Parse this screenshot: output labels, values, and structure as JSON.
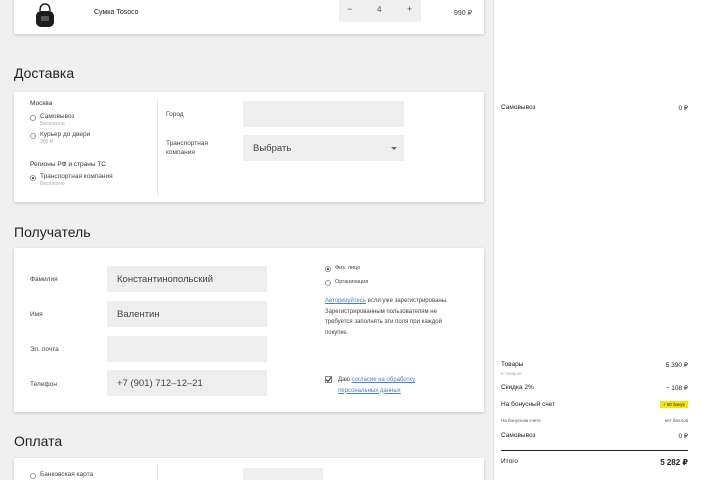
{
  "product": {
    "name": "Сумка Tosoco",
    "qty": "4",
    "minus": "−",
    "plus": "+",
    "price": "990 ₽"
  },
  "delivery": {
    "title": "Доставка",
    "moscow": {
      "heading": "Москва",
      "pickup": "Самовывоз",
      "pickup_sub": "Бесплатно",
      "courier": "Курьер до двери",
      "courier_sub": "300 ₽"
    },
    "regions": {
      "heading": "Регионы РФ и страны ТС",
      "tk": "Транспортная компания",
      "tk_sub": "Бесплатно"
    },
    "city_label": "Город",
    "tk_label": "Транспортная компания",
    "select_value": "Выбрать"
  },
  "recipient": {
    "title": "Получатель",
    "surname_label": "Фамилия",
    "surname_value": "Константинопольский",
    "name_label": "Имя",
    "name_value": "Валентин",
    "email_label": "Эл. почта",
    "email_value": "",
    "phone_label": "Телефон",
    "phone_value": "+7 (901) 712–12–21",
    "person_individual": "Физ. лицо",
    "person_org": "Организация",
    "auth_link": "Авторизуйтесь",
    "auth_rest": "если уже зарегистрированы. Зарегистрированным пользователям не требуется заполнять эти поля при каждой покупке.",
    "consent_prefix": "Даю",
    "consent_link": "согласие на обработку персональных данных"
  },
  "payment": {
    "title": "Оплата",
    "bank_card": "Банковская карта"
  },
  "summary": {
    "pickup_label": "Самовывоз",
    "pickup_value": "0 ₽",
    "goods_label": "Товары",
    "goods_value": "5 390 ₽",
    "goods_sub": "5 товаров",
    "discount_label": "Скидка 2%",
    "discount_value": "− 108 ₽",
    "bonus_label": "На бонусный счет",
    "bonus_value": "+ 50 бонус",
    "bonus_sub_label": "На бонусном счете",
    "bonus_sub_value": "нет баллов",
    "pickup2_label": "Самовывоз",
    "pickup2_value": "0 ₽",
    "total_label": "Итого",
    "total_value": "5 282 ₽"
  },
  "colors": {
    "accent_link": "#4a7fd0",
    "bonus_badge": "#f5e600"
  }
}
